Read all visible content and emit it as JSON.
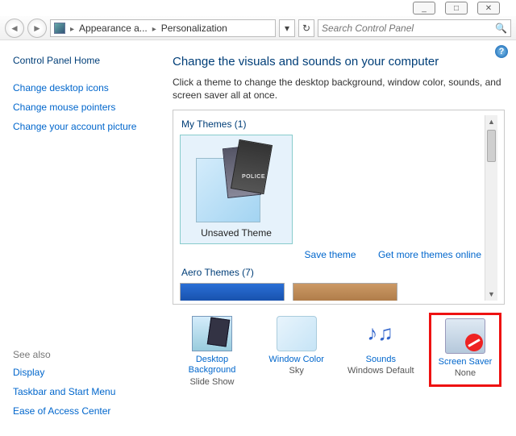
{
  "window_controls": {
    "min": "_",
    "max": "□",
    "close": "✕"
  },
  "nav": {
    "back_glyph": "◄",
    "forward_glyph": "►"
  },
  "breadcrumb": {
    "item1": "Appearance a...",
    "item2": "Personalization"
  },
  "refresh_glyph": "↻",
  "dropdown_glyph": "▾",
  "search": {
    "placeholder": "Search Control Panel"
  },
  "help_glyph": "?",
  "sidebar": {
    "home": "Control Panel Home",
    "links": {
      "icons": "Change desktop icons",
      "pointers": "Change mouse pointers",
      "picture": "Change your account picture"
    },
    "seealso_label": "See also",
    "seealso": {
      "display": "Display",
      "taskbar": "Taskbar and Start Menu",
      "ease": "Ease of Access Center"
    }
  },
  "main": {
    "heading": "Change the visuals and sounds on your computer",
    "subtext": "Click a theme to change the desktop background, window color, sounds, and screen saver all at once.",
    "mythemes_label": "My Themes (1)",
    "theme_caption": "Unsaved Theme",
    "theme_police": "POLICE",
    "save_theme": "Save theme",
    "more_online": "Get more themes online",
    "aero_label": "Aero Themes (7)"
  },
  "actions": {
    "desktop": {
      "label": "Desktop Background",
      "sub": "Slide Show"
    },
    "wincolor": {
      "label": "Window Color",
      "sub": "Sky"
    },
    "sounds": {
      "label": "Sounds",
      "sub": "Windows Default"
    },
    "screensaver": {
      "label": "Screen Saver",
      "sub": "None"
    }
  },
  "scroll": {
    "up": "▲",
    "down": "▼"
  }
}
